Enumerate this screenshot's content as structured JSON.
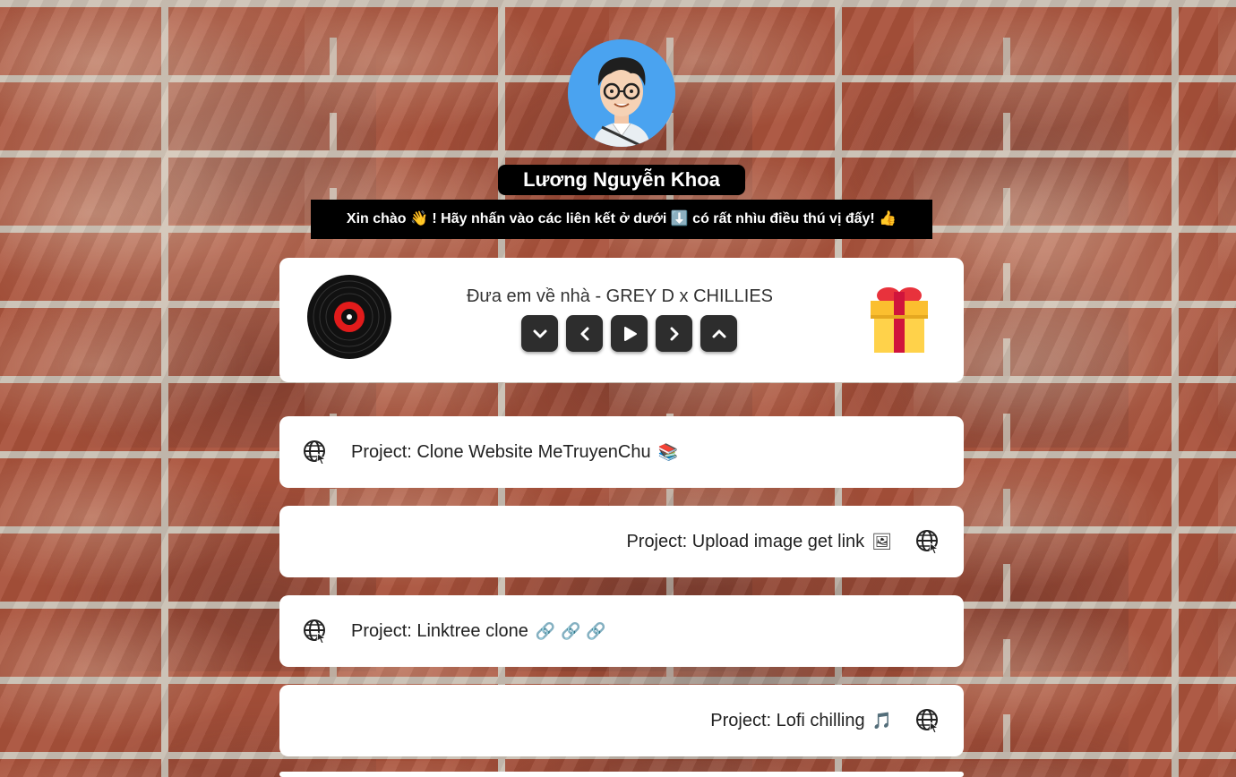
{
  "profile": {
    "name": "Lương Nguyễn Khoa",
    "greeting": "Xin chào 👋 ! Hãy nhấn vào các liên kết ở dưới ⬇️ có rất nhìu điều thú vị đấy! 👍"
  },
  "player": {
    "song_title": "Đưa em về nhà - GREY D x CHILLIES",
    "controls": [
      "chevron-down",
      "previous",
      "play",
      "next",
      "chevron-up"
    ]
  },
  "links": [
    {
      "label": "Project: Clone Website MeTruyenChu",
      "emoji": "📚",
      "align": "left"
    },
    {
      "label": "Project: Upload image get link",
      "emoji": "🖼",
      "align": "right"
    },
    {
      "label": "Project: Linktree clone",
      "emoji": "🔗 🔗 🔗",
      "align": "left"
    },
    {
      "label": "Project: Lofi chilling",
      "emoji": "🎵",
      "align": "right"
    }
  ],
  "colors": {
    "card": "#ffffff",
    "control": "#2d2d2d",
    "label_bg": "#000000",
    "avatar_bg": "#4aa3f0"
  }
}
